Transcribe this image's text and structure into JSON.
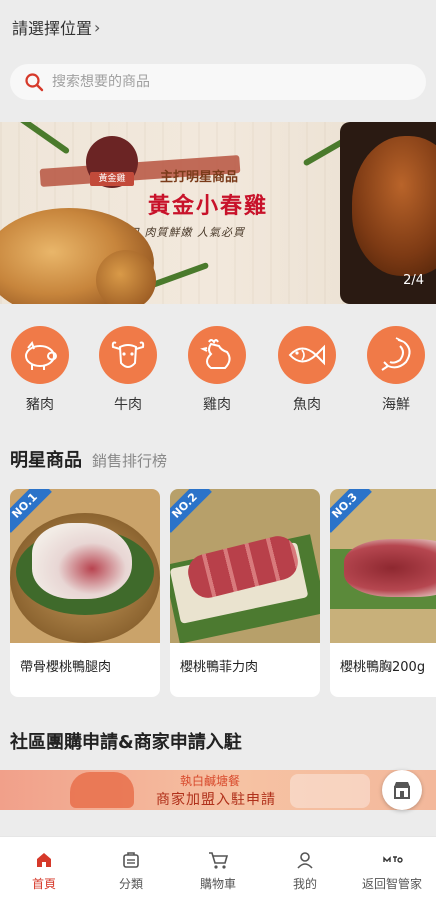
{
  "header": {
    "location_label": "請選擇位置",
    "chevron": "chevron-right-icon"
  },
  "search": {
    "placeholder": "搜索想要的商品",
    "icon": "search-icon"
  },
  "banner": {
    "seal_text": "黃金雞",
    "line1": "主打明星商品",
    "line2": "黃金小春雞",
    "line3": "香酥可口 肉質鮮嫩 人氣必買",
    "counter": "2/4"
  },
  "categories": [
    {
      "label": "豬肉",
      "icon": "pig-icon"
    },
    {
      "label": "牛肉",
      "icon": "cow-icon"
    },
    {
      "label": "雞肉",
      "icon": "chicken-icon"
    },
    {
      "label": "魚肉",
      "icon": "fish-icon"
    },
    {
      "label": "海鮮",
      "icon": "shrimp-icon"
    }
  ],
  "featured": {
    "title": "明星商品",
    "subtitle": "銷售排行榜",
    "products": [
      {
        "badge": "NO.1",
        "name": "帶骨櫻桃鴨腿肉"
      },
      {
        "badge": "NO.2",
        "name": "櫻桃鴨菲力肉"
      },
      {
        "badge": "NO.3",
        "name": "櫻桃鴨胸200g"
      }
    ]
  },
  "community": {
    "title": "社區團購申請&商家申請入駐",
    "promo_line1": "執白鹹塘餐",
    "promo_line2": "商家加盟入駐申請"
  },
  "tabbar": {
    "items": [
      {
        "label": "首頁",
        "icon": "home-icon"
      },
      {
        "label": "分類",
        "icon": "category-icon"
      },
      {
        "label": "購物車",
        "icon": "cart-icon"
      },
      {
        "label": "我的",
        "icon": "user-icon"
      },
      {
        "label": "返回智管家",
        "icon": "return-icon"
      }
    ]
  },
  "colors": {
    "accent": "#f07a48",
    "active_tab": "#d6392a",
    "badge": "#2b73c9",
    "banner_title": "#c8122a"
  }
}
